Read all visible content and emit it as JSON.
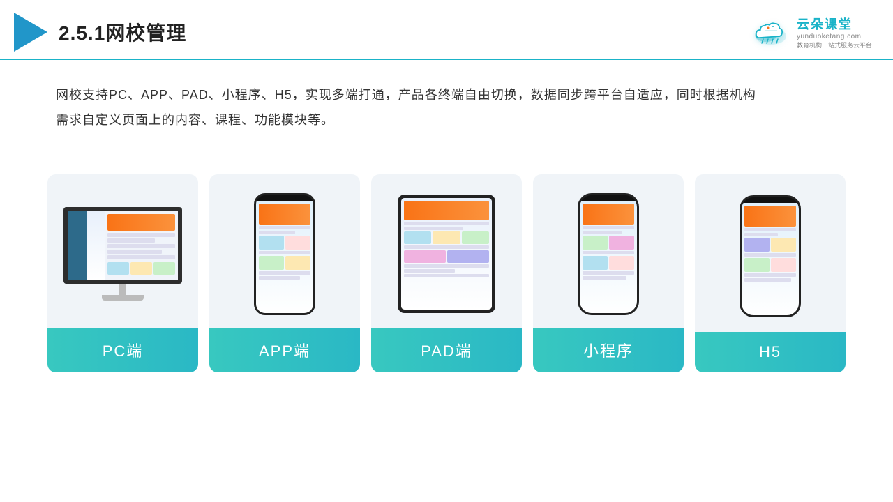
{
  "header": {
    "title": "2.5.1网校管理",
    "logo_name": "云朵课堂",
    "logo_sub": "yunduoketang.com",
    "logo_tagline": "教育机构一站\n式服务云平台"
  },
  "description": {
    "text": "网校支持PC、APP、PAD、小程序、H5，实现多端打通，产品各终端自由切换，数据同步跨平台自适应，同时根据机构",
    "text2": "需求自定义页面上的内容、课程、功能模块等。"
  },
  "cards": [
    {
      "id": "pc",
      "label": "PC端"
    },
    {
      "id": "app",
      "label": "APP端"
    },
    {
      "id": "pad",
      "label": "PAD端"
    },
    {
      "id": "miniprogram",
      "label": "小程序"
    },
    {
      "id": "h5",
      "label": "H5"
    }
  ]
}
